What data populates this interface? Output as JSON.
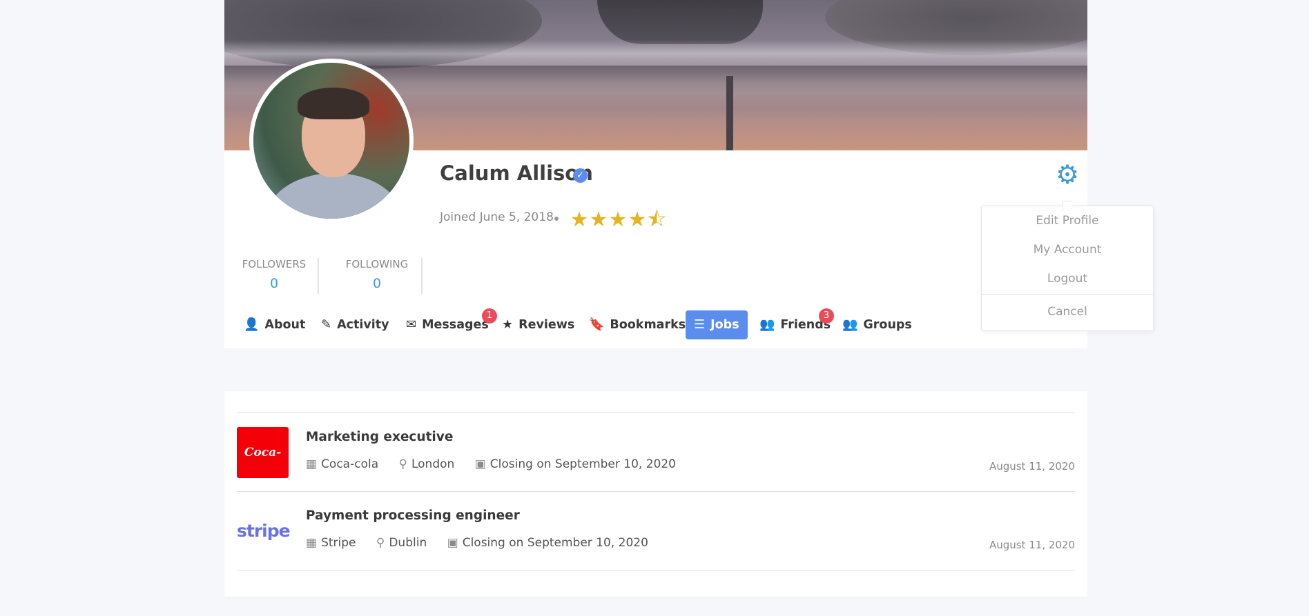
{
  "profile": {
    "name": "Calum Allison",
    "joined": "Joined June 5, 2018",
    "rating_value": 4.5,
    "rating_max": 5
  },
  "stats": [
    {
      "label": "FOLLOWERS",
      "value": "0"
    },
    {
      "label": "FOLLOWING",
      "value": "0"
    }
  ],
  "tabs": [
    {
      "label": "About",
      "icon": "user-icon"
    },
    {
      "label": "Activity",
      "icon": "edit-icon"
    },
    {
      "label": "Messages",
      "icon": "envelope-icon",
      "badge": "1"
    },
    {
      "label": "Reviews",
      "icon": "star-icon"
    },
    {
      "label": "Bookmarks",
      "icon": "bookmark-icon"
    },
    {
      "label": "Jobs",
      "icon": "list-alt-icon",
      "active": true
    },
    {
      "label": "Friends",
      "icon": "users-icon",
      "badge": "3"
    },
    {
      "label": "Groups",
      "icon": "users-icon"
    }
  ],
  "menu": {
    "edit_profile": "Edit Profile",
    "my_account": "My Account",
    "logout": "Logout",
    "cancel": "Cancel"
  },
  "jobs": [
    {
      "logo": "Coca-Cola",
      "title": "Marketing executive",
      "company": "Coca-cola",
      "location": "London",
      "closing": "Closing on September 10, 2020",
      "date": "August 11, 2020"
    },
    {
      "logo": "stripe",
      "title": "Payment processing engineer",
      "company": "Stripe",
      "location": "Dublin",
      "closing": "Closing on September 10, 2020",
      "date": "August 11, 2020"
    }
  ],
  "colors": {
    "accent": "#5b8def",
    "link": "#3d9bd8",
    "badge": "#e84b5a",
    "star": "#e6b321"
  }
}
